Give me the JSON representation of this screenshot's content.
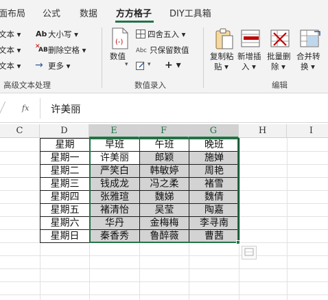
{
  "tabs": [
    {
      "label": "面布局",
      "active": false
    },
    {
      "label": "公式",
      "active": false
    },
    {
      "label": "数据",
      "active": false
    },
    {
      "label": "方方格子",
      "active": true
    },
    {
      "label": "DIY工具箱",
      "active": false
    }
  ],
  "ribbon": {
    "group1": {
      "items": [
        "文本 ▾",
        "文本 ▾",
        "文本 ▾"
      ],
      "label": "高级文本处理"
    },
    "group1b": {
      "case_label": "大小写 ▾",
      "case_icon_text": "Ab",
      "delete_space_label": "删除空格 ▾",
      "delete_space_icon_text": "AB",
      "more_label": "更多 ▾"
    },
    "group2": {
      "value_label": "数值",
      "round_label": "四舍五入 ▾",
      "keep_value_label": "只保留数值",
      "keep_value_icon_text": "Abc",
      "plus_label": "+ ▾",
      "label": "数值录入"
    },
    "group3": {
      "copy_paste": [
        "复制粘",
        "贴 ▾"
      ],
      "new_insert": [
        "新增插",
        "入 ▾"
      ],
      "batch_delete": [
        "批量删",
        "除 ▾"
      ],
      "merge_convert": [
        "合并转",
        "换 ▾"
      ],
      "label": "编辑"
    }
  },
  "formula_bar": {
    "fx_label": "fx",
    "value": "许美丽"
  },
  "columns": [
    {
      "label": "C",
      "selected": false
    },
    {
      "label": "D",
      "selected": false
    },
    {
      "label": "E",
      "selected": true
    },
    {
      "label": "F",
      "selected": true
    },
    {
      "label": "G",
      "selected": true
    },
    {
      "label": "H",
      "selected": false
    },
    {
      "label": "I",
      "selected": false
    }
  ],
  "table": {
    "header": [
      "星期",
      "早班",
      "午班",
      "晚班"
    ],
    "rows": [
      [
        "星期一",
        "许美丽",
        "郎颖",
        "施婵"
      ],
      [
        "星期二",
        "严笑白",
        "韩敏婷",
        "周艳"
      ],
      [
        "星期三",
        "钱成龙",
        "冯之柔",
        "褚雪"
      ],
      [
        "星期四",
        "张雅瑄",
        "魏娣",
        "魏倩"
      ],
      [
        "星期五",
        "褚清怡",
        "吴莹",
        "陶嘉"
      ],
      [
        "星期六",
        "华丹",
        "金梅梅",
        "李寻南"
      ],
      [
        "星期日",
        "秦香秀",
        "鲁醉薇",
        "曹茜"
      ]
    ]
  },
  "colors": {
    "accent": "#217346",
    "selection_fill": "#d3d3d3"
  }
}
